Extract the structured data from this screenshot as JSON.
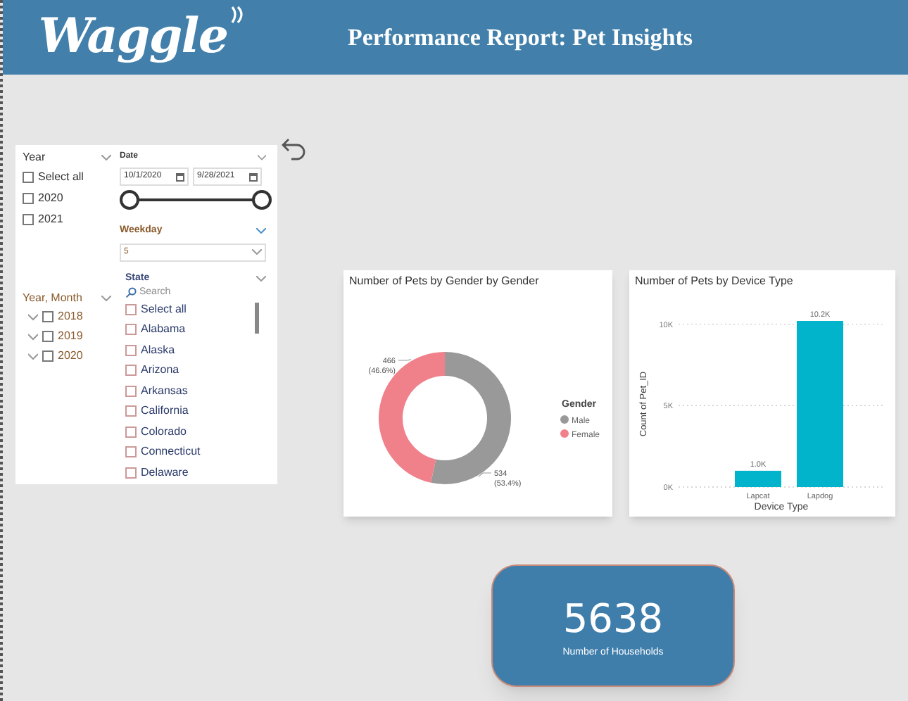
{
  "header": {
    "logo": "Waggle",
    "title": "Performance Report: Pet Insights"
  },
  "year_slicer": {
    "title": "Year",
    "items": [
      {
        "label": "Select all",
        "checked": false
      },
      {
        "label": "2020",
        "checked": false
      },
      {
        "label": "2021",
        "checked": false
      }
    ]
  },
  "date_slicer": {
    "title": "Date",
    "start": "10/1/2020",
    "end": "9/28/2021",
    "handles": [
      {
        "level": 0
      },
      {
        "level": 1
      }
    ]
  },
  "weekday_slicer": {
    "title": "Weekday",
    "value": "5"
  },
  "year_month_slicer": {
    "title": "Year, Month",
    "items": [
      {
        "label": "2018",
        "expanded": false,
        "checked": false
      },
      {
        "label": "2019",
        "expanded": false,
        "checked": false
      },
      {
        "label": "2020",
        "expanded": false,
        "checked": false
      }
    ]
  },
  "state_slicer": {
    "title": "State",
    "search": {
      "placeholder": "Search"
    },
    "items": [
      {
        "label": "Select all",
        "checked": false
      },
      {
        "label": "Alabama",
        "checked": false
      },
      {
        "label": "Alaska",
        "checked": false
      },
      {
        "label": "Arizona",
        "checked": false
      },
      {
        "label": "Arkansas",
        "checked": false
      },
      {
        "label": "California",
        "checked": false
      },
      {
        "label": "Colorado",
        "checked": false
      },
      {
        "label": "Connecticut",
        "checked": false
      },
      {
        "label": "Delaware",
        "checked": false
      }
    ]
  },
  "gender_chart": {
    "chart_data": {
      "type": "donut",
      "title": "Number of Pets by Gender by Gender",
      "categories": [
        "Male",
        "Female"
      ],
      "values": [
        534,
        466
      ],
      "colors": [
        "#999999",
        "#f0808a"
      ],
      "value_labels": [
        "534 (53.4%)",
        "466 (46.6%)"
      ],
      "legend": {
        "title": "Gender"
      }
    }
  },
  "device_chart": {
    "chart_data": {
      "type": "bar",
      "title": "Number of Pets by Device Type",
      "xlabel": "Device Type",
      "ylabel": "Count of Pet_ID",
      "categories": [
        "Lapcat",
        "Lapdog"
      ],
      "values": [
        1000,
        10200
      ],
      "color": "#01b4cc",
      "ylim": [
        0,
        10200
      ],
      "yticks": [
        {
          "value": 0,
          "label": "0K"
        },
        {
          "value": 5000,
          "label": "5K"
        },
        {
          "value": 10000,
          "label": "10K"
        }
      ],
      "value_labels": [
        "1.0K",
        "10.2K"
      ]
    }
  },
  "kpi_card": {
    "value": "5638",
    "label": "Number of Households"
  }
}
